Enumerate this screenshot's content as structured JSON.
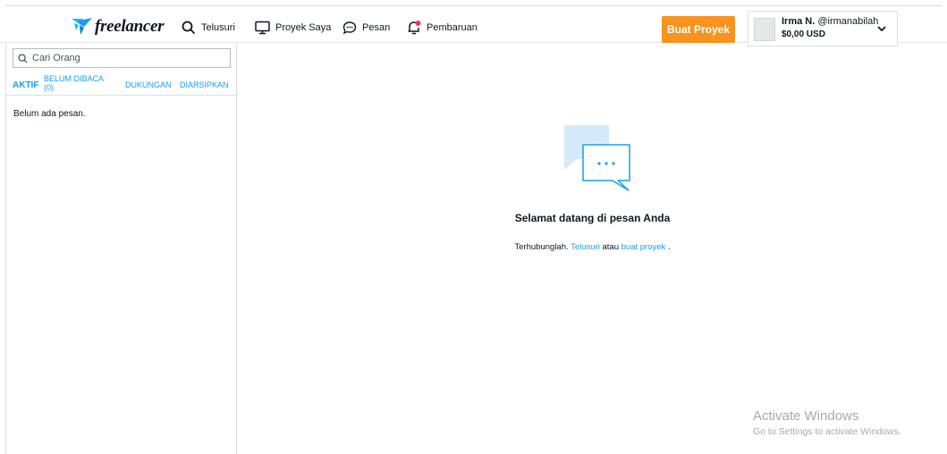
{
  "brand": {
    "logo_text": "freelancer"
  },
  "nav": {
    "browse": "Telusuri",
    "my_projects": "Proyek Saya",
    "messages": "Pesan",
    "updates": "Pembaruan"
  },
  "header": {
    "create_project": "Buat Proyek",
    "user": {
      "name": "Irma N.",
      "handle": "@irmanabilah",
      "balance": "$0,00 USD"
    }
  },
  "sidebar": {
    "search_placeholder": "Cari Orang",
    "tabs": {
      "active": "AKTIF",
      "unread_line1": "BELUM DIBACA",
      "unread_line2": "(0)",
      "support": "DUKUNGAN",
      "archived": "DIARSIPKAN"
    },
    "empty_message": "Belum ada pesan."
  },
  "main": {
    "title": "Selamat datang di pesan Anda",
    "sub_prefix": "Terhubunglah.",
    "sub_link1": "Telusuri",
    "sub_middle": "atau",
    "sub_link2": "buat proyek",
    "sub_suffix": "."
  },
  "watermark": {
    "title": "Activate Windows",
    "subtitle": "Go to Settings to activate Windows."
  },
  "colors": {
    "accent": "#139ff0",
    "create_button": "#f7931e",
    "bubble_light": "#d6ebfa"
  }
}
